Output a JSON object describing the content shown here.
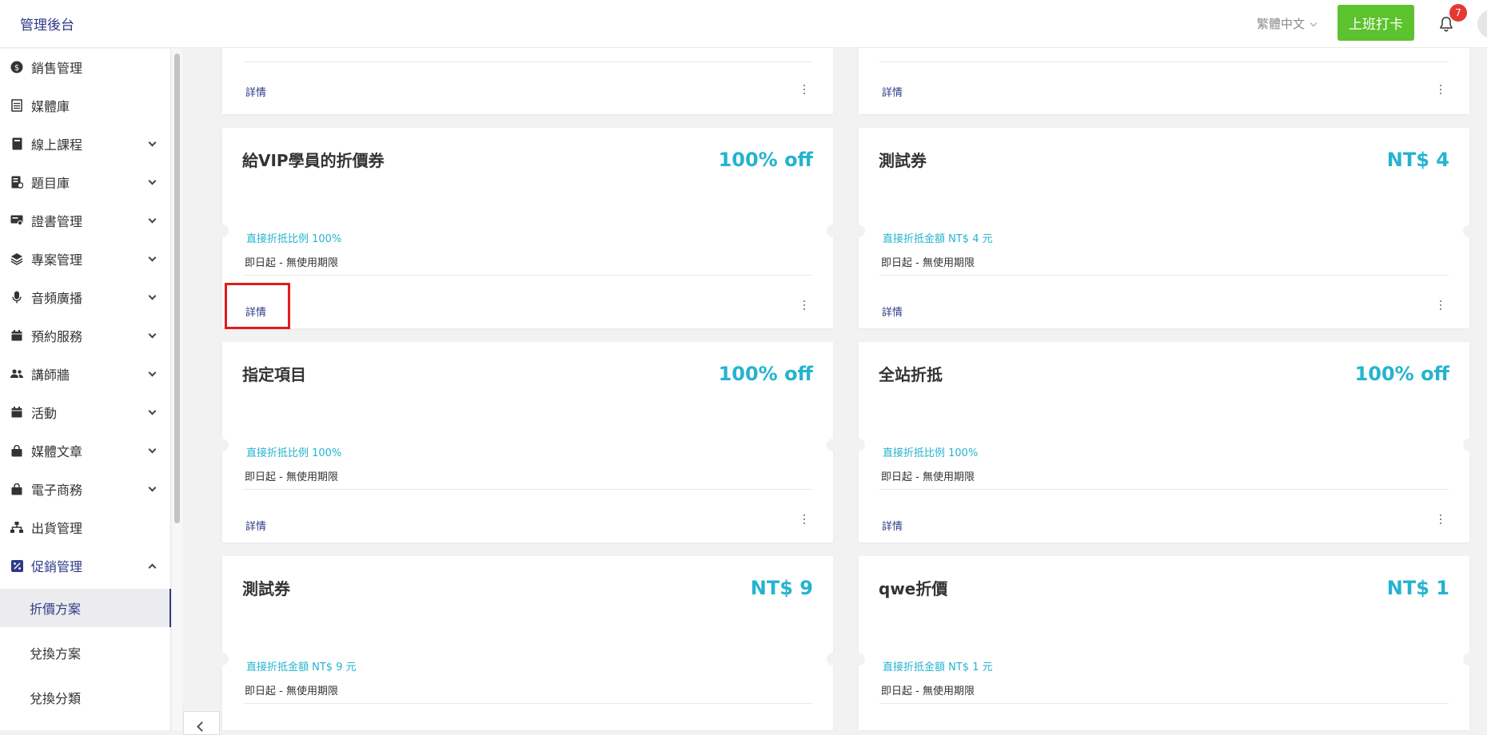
{
  "header": {
    "brand": "管理後台",
    "language": "繁體中文",
    "clock_in_label": "上班打卡",
    "notification_count": "7"
  },
  "sidebar": {
    "items": [
      {
        "label": "銷售管理",
        "icon": "dollar-circle-icon",
        "expandable": false
      },
      {
        "label": "媒體庫",
        "icon": "media-library-icon",
        "expandable": false
      },
      {
        "label": "線上課程",
        "icon": "book-icon",
        "expandable": true
      },
      {
        "label": "題目庫",
        "icon": "question-bank-icon",
        "expandable": true
      },
      {
        "label": "證書管理",
        "icon": "certificate-icon",
        "expandable": true
      },
      {
        "label": "專案管理",
        "icon": "layers-icon",
        "expandable": true
      },
      {
        "label": "音頻廣播",
        "icon": "microphone-icon",
        "expandable": true
      },
      {
        "label": "預約服務",
        "icon": "calendar-icon",
        "expandable": true
      },
      {
        "label": "講師牆",
        "icon": "users-icon",
        "expandable": true
      },
      {
        "label": "活動",
        "icon": "calendar-icon",
        "expandable": true
      },
      {
        "label": "媒體文章",
        "icon": "shopping-bag-icon",
        "expandable": true
      },
      {
        "label": "電子商務",
        "icon": "shopping-bag-icon",
        "expandable": true
      },
      {
        "label": "出貨管理",
        "icon": "sitemap-icon",
        "expandable": false
      },
      {
        "label": "促銷管理",
        "icon": "percent-icon",
        "expandable": true
      }
    ],
    "sub_items": [
      "折價方案",
      "兌換方案",
      "兌換分類"
    ]
  },
  "cards_top_partial": {
    "details_label": "詳情"
  },
  "cards": [
    {
      "title": "給VIP學員的折價券",
      "value": "100% off",
      "rule": "直接折抵比例 100%",
      "period": "即日起 - 無使用期限",
      "details": "詳情"
    },
    {
      "title": "測試券",
      "value": "NT$ 4",
      "rule": "直接折抵金額 NT$ 4 元",
      "period": "即日起 - 無使用期限",
      "details": "詳情"
    },
    {
      "title": "指定項目",
      "value": "100% off",
      "rule": "直接折抵比例 100%",
      "period": "即日起 - 無使用期限",
      "details": "詳情"
    },
    {
      "title": "全站折抵",
      "value": "100% off",
      "rule": "直接折抵比例 100%",
      "period": "即日起 - 無使用期限",
      "details": "詳情"
    },
    {
      "title": "測試券",
      "value": "NT$ 9",
      "rule": "直接折抵金額 NT$ 9 元",
      "period": "即日起 - 無使用期限",
      "details": "詳情"
    },
    {
      "title": "qwe折價",
      "value": "NT$ 1",
      "rule": "直接折抵金額 NT$ 1 元",
      "period": "即日起 - 無使用期限",
      "details": "詳情"
    }
  ],
  "colors": {
    "brand": "#2e3a87",
    "accent": "#25b3d0",
    "clock_in": "#5cc22d",
    "badge": "#e53935",
    "highlight": "#e21c1c"
  }
}
